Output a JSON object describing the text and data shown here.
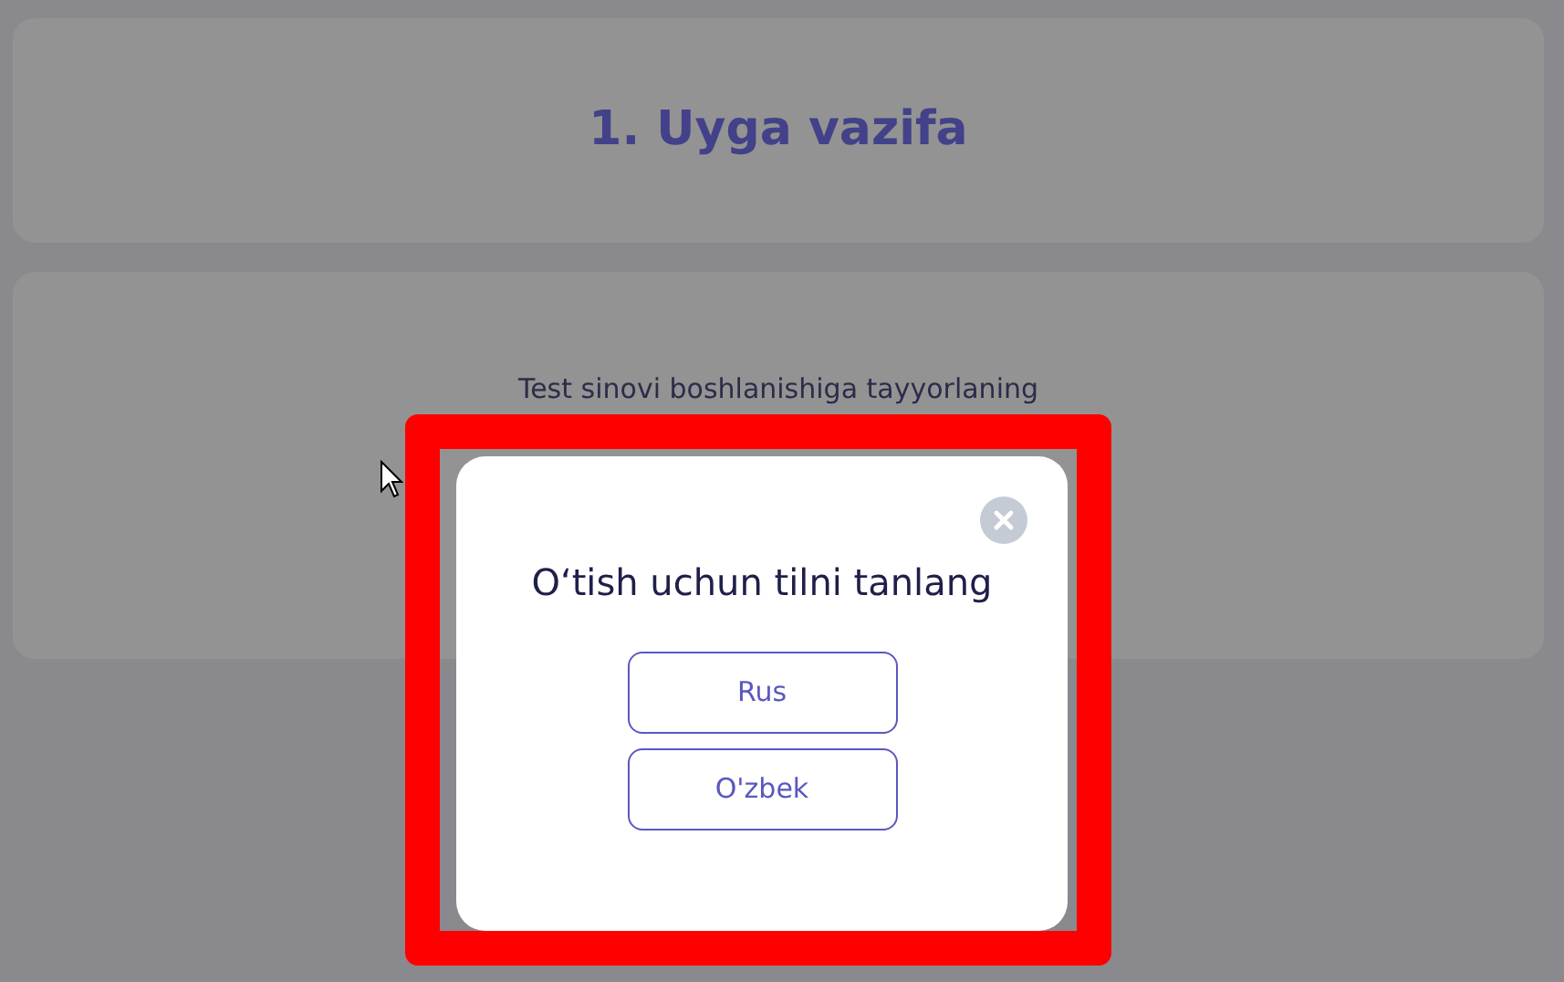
{
  "page": {
    "title": "1. Uyga vazifa",
    "message": "Test sinovi boshlanishiga tayyorlaning"
  },
  "modal": {
    "title": "O‘tish uchun tilni tanlang",
    "close": true,
    "buttons": [
      {
        "label": "Rus"
      },
      {
        "label": "O'zbek"
      }
    ]
  },
  "highlight": true
}
